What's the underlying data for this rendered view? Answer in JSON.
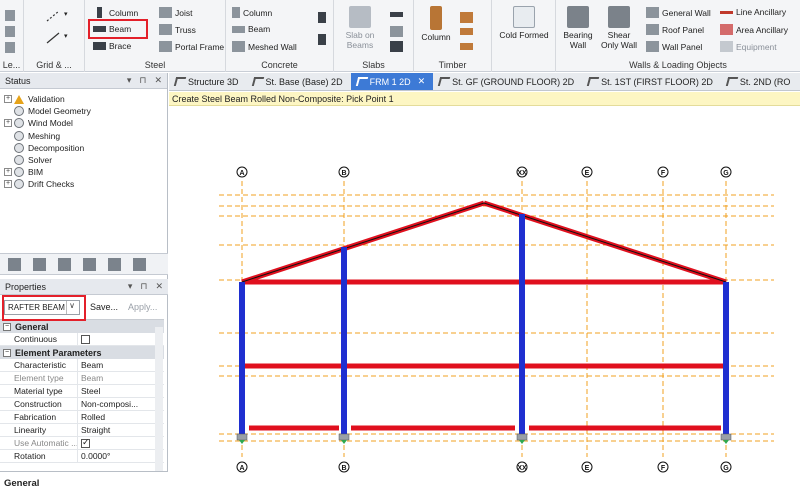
{
  "ribbon": {
    "groups": [
      {
        "label": "Le..."
      },
      {
        "label": "Grid & ..."
      },
      {
        "label": "Steel"
      },
      {
        "label": "Concrete"
      },
      {
        "label": "Slabs"
      },
      {
        "label": "Timber"
      },
      {
        "label": "Walls & Loading Objects"
      }
    ],
    "steel": {
      "column": "Column",
      "beam": "Beam",
      "brace": "Brace",
      "joist": "Joist",
      "truss": "Truss",
      "portal_frame": "Portal Frame"
    },
    "concrete": {
      "column": "Column",
      "beam": "Beam",
      "meshed_wall": "Meshed Wall"
    },
    "slabs": {
      "slab_on_beams": "Slab on Beams"
    },
    "timber": {
      "column": "Column"
    },
    "cold_formed": "Cold Formed",
    "walls": {
      "bearing_wall": "Bearing Wall",
      "shear_only_wall": "Shear Only Wall",
      "general_wall": "General Wall",
      "roof_panel": "Roof Panel",
      "wall_panel": "Wall Panel",
      "line_ancillary": "Line Ancillary",
      "area_ancillary": "Area Ancillary",
      "equipment": "Equipment"
    }
  },
  "status_panel": {
    "title": "Status",
    "items": [
      {
        "label": "Validation",
        "icon": "warning-icon",
        "expandable": true
      },
      {
        "label": "Model Geometry",
        "icon": "check-icon",
        "expandable": false
      },
      {
        "label": "Wind Model",
        "icon": "check-icon",
        "expandable": true
      },
      {
        "label": "Meshing",
        "icon": "check-icon",
        "expandable": false
      },
      {
        "label": "Decomposition",
        "icon": "check-icon",
        "expandable": false
      },
      {
        "label": "Solver",
        "icon": "check-icon",
        "expandable": false
      },
      {
        "label": "BIM",
        "icon": "check-icon",
        "expandable": true
      },
      {
        "label": "Drift Checks",
        "icon": "check-icon",
        "expandable": true
      }
    ]
  },
  "properties": {
    "title": "Properties",
    "selected_type": "RAFTER BEAM",
    "save_label": "Save...",
    "apply_label": "Apply...",
    "sections": {
      "general": "General",
      "element_parameters": "Element Parameters"
    },
    "rows": {
      "continuous": {
        "label": "Continuous",
        "value": ""
      },
      "characteristic": {
        "label": "Characteristic",
        "value": "Beam"
      },
      "element_type": {
        "label": "Element type",
        "value": "Beam"
      },
      "material_type": {
        "label": "Material type",
        "value": "Steel"
      },
      "construction": {
        "label": "Construction",
        "value": "Non-composi..."
      },
      "fabrication": {
        "label": "Fabrication",
        "value": "Rolled"
      },
      "linearity": {
        "label": "Linearity",
        "value": "Straight"
      },
      "use_automatic": {
        "label": "Use Automatic ...",
        "value": ""
      },
      "rotation": {
        "label": "Rotation",
        "value": "0.0000°"
      }
    },
    "footer": "General"
  },
  "tabs": [
    {
      "label": "Structure 3D",
      "active": false,
      "closable": false
    },
    {
      "label": "St. Base (Base) 2D",
      "active": false,
      "closable": false
    },
    {
      "label": "FRM 1 2D",
      "active": true,
      "closable": true
    },
    {
      "label": "St. GF (GROUND FLOOR) 2D",
      "active": false,
      "closable": false
    },
    {
      "label": "St. 1ST (FIRST FLOOR) 2D",
      "active": false,
      "closable": false
    },
    {
      "label": "St. 2ND (RO",
      "active": false,
      "closable": false
    }
  ],
  "command_prompt": "Create Steel Beam Rolled Non-Composite: Pick Point 1",
  "gridlines": [
    "A",
    "B",
    "XX",
    "E",
    "F",
    "G"
  ],
  "colors": {
    "column": "#1f2fd0",
    "beam": "#e0101e",
    "grid": "#f0a020",
    "tab_active": "#3d7ad6",
    "highlight": "#e3202a"
  }
}
